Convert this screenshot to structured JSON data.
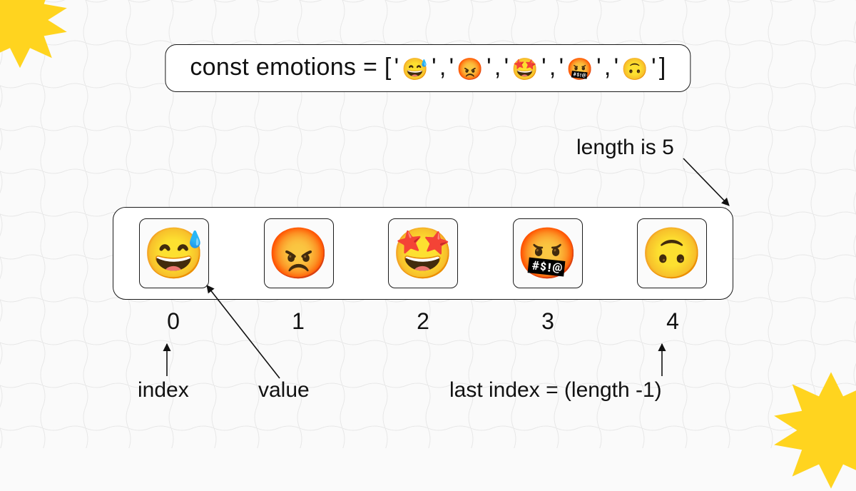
{
  "code": {
    "prefix": "const emotions = [",
    "items": [
      "😅",
      "😡",
      "🤩",
      "🤬",
      "🙃"
    ],
    "sep": ",",
    "quote": "'",
    "suffix": "]"
  },
  "array": {
    "cells": [
      "😅",
      "😡",
      "🤩",
      "🤬",
      "🙃"
    ],
    "indices": [
      "0",
      "1",
      "2",
      "3",
      "4"
    ]
  },
  "labels": {
    "length": "length  is 5",
    "index": "index",
    "value": "value",
    "last": "last index = (length -1)"
  }
}
